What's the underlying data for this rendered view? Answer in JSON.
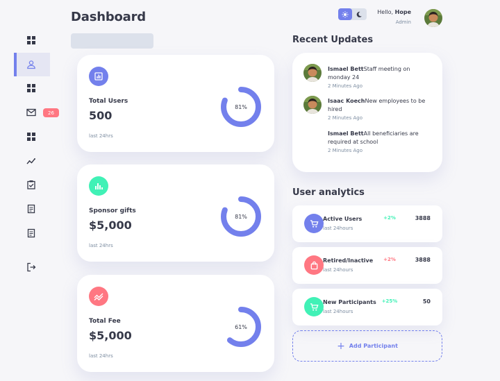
{
  "page": {
    "title": "Dashboard"
  },
  "header": {
    "greeting_prefix": "Hello,",
    "user_name": "Hope",
    "user_role": "Admin",
    "theme_toggle": {
      "light_icon": "sun-icon",
      "dark_icon": "moon-icon",
      "active": "light"
    }
  },
  "sidebar": {
    "items": [
      {
        "icon": "grid-icon"
      },
      {
        "icon": "person-icon",
        "active": true
      },
      {
        "icon": "grid-icon"
      },
      {
        "icon": "mail-icon",
        "badge": "26"
      },
      {
        "icon": "grid-icon"
      },
      {
        "icon": "insights-icon"
      },
      {
        "icon": "clipboard-check-icon"
      },
      {
        "icon": "report-icon"
      },
      {
        "icon": "report-icon"
      },
      {
        "icon": "logout-icon"
      }
    ]
  },
  "stats": [
    {
      "label": "Total Users",
      "value": "500",
      "percent_label": "81%",
      "percent": 81,
      "foot": "last 24hrs",
      "icon": "bar-chart-icon",
      "color": "#7380ec"
    },
    {
      "label": "Sponsor gifts",
      "value": "$5,000",
      "percent_label": "81%",
      "percent": 81,
      "foot": "last 24hrs",
      "icon": "stats-icon",
      "color": "#41f1b6"
    },
    {
      "label": "Total Fee",
      "value": "$5,000",
      "percent_label": "61%",
      "percent": 61,
      "foot": "last 24hrs",
      "icon": "trending-icon",
      "color": "#ff7782"
    }
  ],
  "recent_updates": {
    "title": "Recent Updates",
    "items": [
      {
        "name": "Ismael Bett",
        "message": "Staff meeting on monday 24",
        "time": "2 Minutes Ago",
        "has_avatar": true
      },
      {
        "name": "Isaac Koech",
        "message": "New employees to be hired",
        "time": "2 Minutes Ago",
        "has_avatar": true
      },
      {
        "name": "Ismael Bett",
        "message": "All beneficiaries are required at school",
        "time": "2 Minutes Ago",
        "has_avatar": false
      }
    ]
  },
  "analytics": {
    "title": "User analytics",
    "items": [
      {
        "name": "Active Users",
        "sub": "last 24hours",
        "change": "+2%",
        "change_color": "#41f1b6",
        "value": "3888",
        "icon": "cart-icon",
        "icon_bg": "#7380ec"
      },
      {
        "name": "Retired/Inactive",
        "sub": "last 24hours",
        "change": "+2%",
        "change_color": "#ff7782",
        "value": "3888",
        "icon": "bag-icon",
        "icon_bg": "#ff7782"
      },
      {
        "name": "New Participants",
        "sub": "last 24hours",
        "change": "+25%",
        "change_color": "#41f1b6",
        "value": "50",
        "icon": "cart-icon",
        "icon_bg": "#41f1b6"
      }
    ],
    "add_label": "Add Participant",
    "add_icon": "plus-icon"
  },
  "colors": {
    "primary": "#7380ec",
    "success": "#41f1b6",
    "danger": "#ff7782",
    "background": "#f6f6f9",
    "text": "#363949",
    "muted": "#7d8da1"
  }
}
